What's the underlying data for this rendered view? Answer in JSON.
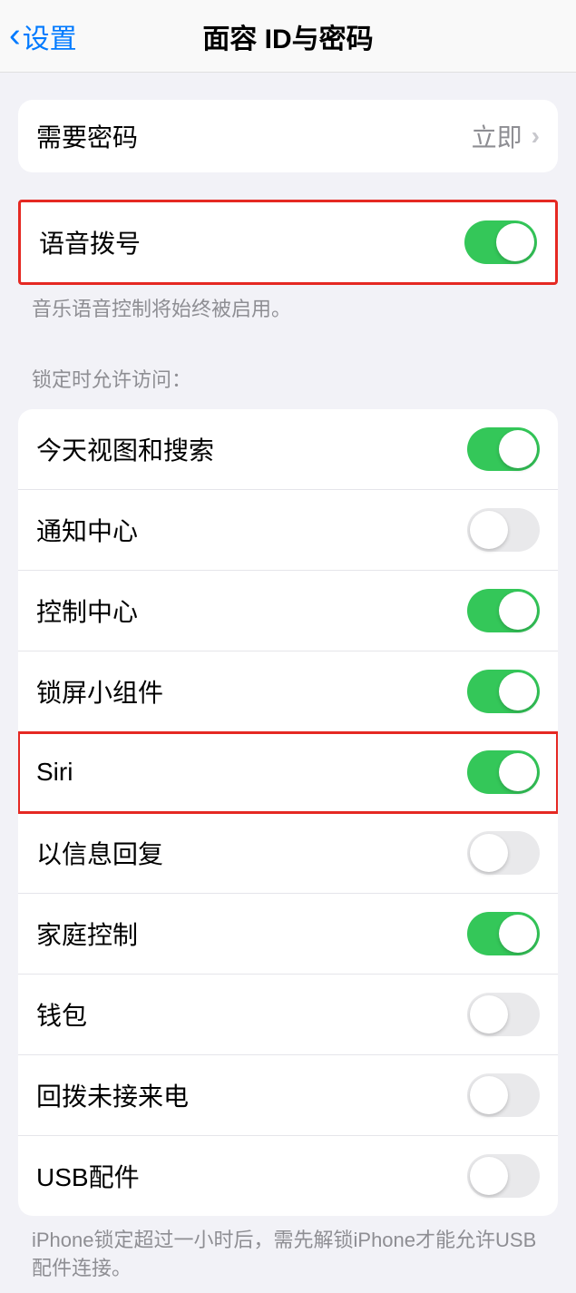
{
  "header": {
    "back_label": "设置",
    "title": "面容 ID与密码"
  },
  "passcode_required": {
    "label": "需要密码",
    "value": "立即"
  },
  "voice_dial": {
    "label": "语音拨号",
    "enabled": true,
    "footer": "音乐语音控制将始终被启用。"
  },
  "locked_access": {
    "section_title": "锁定时允许访问：",
    "items": [
      {
        "label": "今天视图和搜索",
        "enabled": true
      },
      {
        "label": "通知中心",
        "enabled": false
      },
      {
        "label": "控制中心",
        "enabled": true
      },
      {
        "label": "锁屏小组件",
        "enabled": true
      },
      {
        "label": "Siri",
        "enabled": true
      },
      {
        "label": "以信息回复",
        "enabled": false
      },
      {
        "label": "家庭控制",
        "enabled": true
      },
      {
        "label": "钱包",
        "enabled": false
      },
      {
        "label": "回拨未接来电",
        "enabled": false
      },
      {
        "label": "USB配件",
        "enabled": false
      }
    ],
    "footer": "iPhone锁定超过一小时后，需先解锁iPhone才能允许USB配件连接。"
  }
}
